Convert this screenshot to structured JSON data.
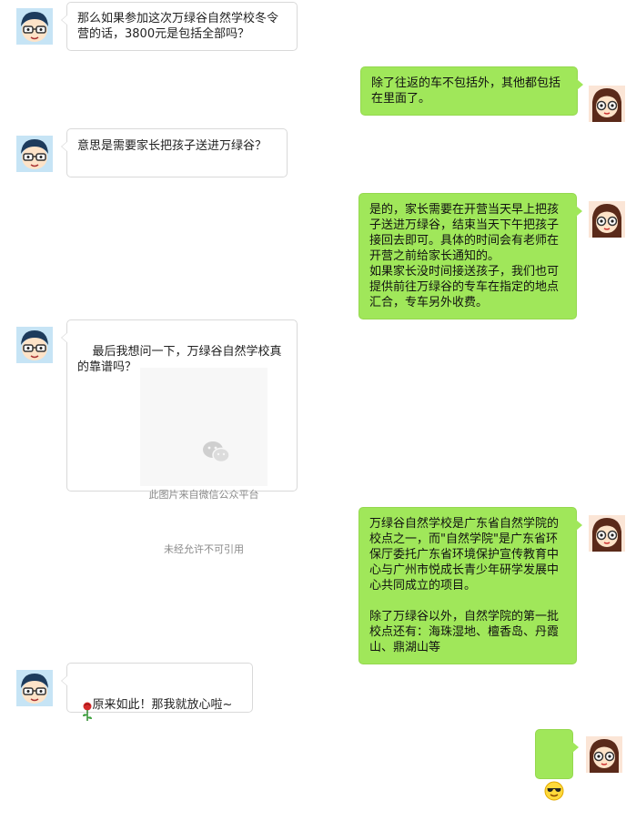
{
  "messages": [
    {
      "sender": "parent",
      "text": "那么如果参加这次万绿谷自然学校冬令营的话，3800元是包括全部吗？"
    },
    {
      "sender": "teacher",
      "text": "除了往返的车不包括外，其他都包括在里面了。"
    },
    {
      "sender": "parent",
      "text": "意思是需要家长把孩子送进万绿谷？"
    },
    {
      "sender": "teacher",
      "text": "是的，家长需要在开营当天早上把孩子送进万绿谷，结束当天下午把孩子接回去即可。具体的时间会有老师在开营之前给家长通知的。\n如果家长没时间接送孩子，我们也可提供前往万绿谷的专车在指定的地点汇合，专车另外收费。"
    },
    {
      "sender": "parent",
      "text": "最后我想问一下，万绿谷自然学校真的靠谱吗？",
      "image_notice": [
        "此图片来自微信公众平台",
        "未经允许不可引用"
      ]
    },
    {
      "sender": "teacher",
      "text": "万绿谷自然学校是广东省自然学院的校点之一，而\"自然学院\"是广东省环保厅委托广东省环境保护宣传教育中心与广州市悦成长青少年研学发展中心共同成立的项目。\n\n除了万绿谷以外，自然学院的第一批校点还有：海珠湿地、檀香岛、丹霞山、鼎湖山等"
    },
    {
      "sender": "parent",
      "text": "原来如此！那我就放心啦~",
      "emoji": "rose-icon"
    },
    {
      "sender": "teacher",
      "text": "",
      "emoji": "sunglasses-smiley-icon"
    }
  ],
  "colors": {
    "outgoing_bubble": "#a0e75a",
    "incoming_bubble": "#ffffff",
    "bubble_border": "#d9d9d9"
  }
}
